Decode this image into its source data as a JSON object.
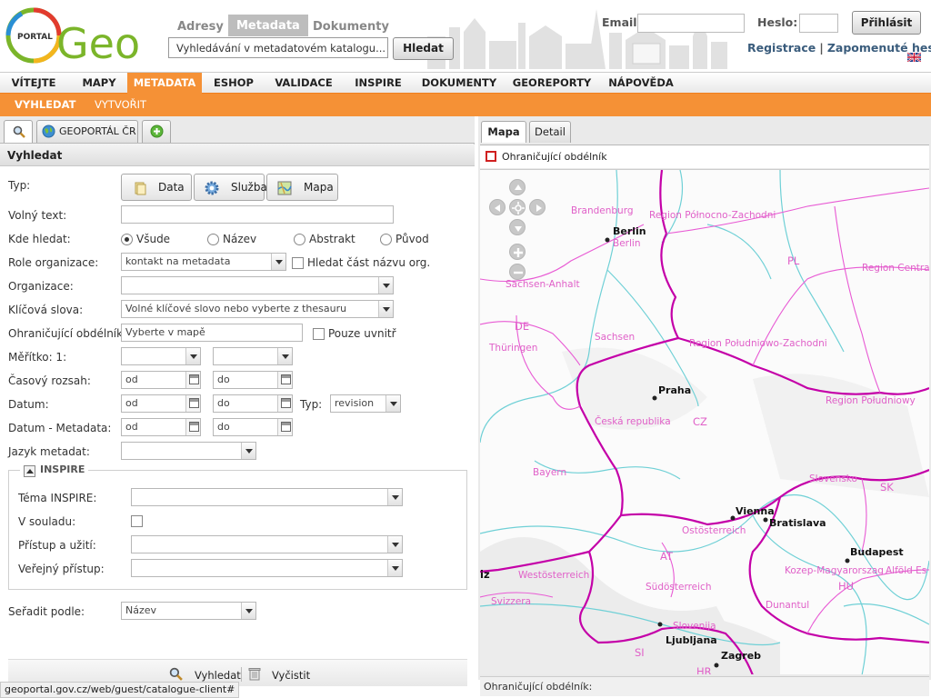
{
  "header": {
    "logo_small": "PORTAL",
    "logo_big": "Geo",
    "topnav": [
      "Adresy",
      "Metadata",
      "Dokumenty"
    ],
    "search_value": "Vyhledávání v metadatovém katalogu...",
    "search_button": "Hledat",
    "email_label": "Email:",
    "password_label": "Heslo:",
    "login_button": "Přihlásit",
    "register_link": "Registrace",
    "separator": "|",
    "forgot_link": "Zapomenuté heslo"
  },
  "mainmenu": [
    "VÍTEJTE",
    "MAPY",
    "METADATA",
    "ESHOP",
    "VALIDACE",
    "INSPIRE",
    "DOKUMENTY",
    "GEOREPORTY",
    "NÁPOVĚDA"
  ],
  "submenu": [
    "VYHLEDAT",
    "VYTVOŘIT"
  ],
  "left": {
    "tab_geoportal": "GEOPORTÁL ČR",
    "section_title": "Vyhledat",
    "labels": {
      "typ": "Typ:",
      "volny_text": "Volný text:",
      "kde_hledat": "Kde hledat:",
      "role": "Role organizace:",
      "organizace": "Organizace:",
      "klicova": "Klíčová slova:",
      "ohranic": "Ohraničující obdélník:",
      "meritko": "Měřítko: 1:",
      "casovy": "Časový rozsah:",
      "datum": "Datum:",
      "datum_meta": "Datum - Metadata:",
      "jazyk": "Jazyk metadat:",
      "seradit": "Seřadit podle:"
    },
    "type_buttons": [
      "Data",
      "Služba",
      "Mapa"
    ],
    "radios": [
      "Všude",
      "Název",
      "Abstrakt",
      "Původ"
    ],
    "role_value": "kontakt na metadata",
    "role_check_label": "Hledat část názvu org.",
    "klicova_placeholder": "Volné klíčové slovo nebo vyberte z thesauru",
    "ohranic_placeholder": "Vyberte v mapě",
    "pouze_uvnitr": "Pouze uvnitř",
    "od": "od",
    "do": "do",
    "typ_label": "Typ:",
    "typ_value": "revision",
    "inspire": {
      "title": "INSPIRE",
      "tema": "Téma INSPIRE:",
      "souladu": "V souladu:",
      "pristup": "Přístup a užití:",
      "verejny": "Veřejný přístup:"
    },
    "sort_value": "Název",
    "btn_search": "Vyhledat",
    "btn_clear": "Vyčistit"
  },
  "right": {
    "tab_map": "Mapa",
    "tab_detail": "Detail",
    "bbox_tool": "Ohraničující obdélník",
    "status_label": "Ohraničující obdélník:",
    "cities": [
      "Berlin",
      "Praha",
      "Vienna",
      "Bratislava",
      "Budapest",
      "Ljubljana",
      "Zagreb"
    ],
    "regions": [
      "Brandenburg",
      "Region Północno-Zachodni",
      "Berlin",
      "PL",
      "Region Centra",
      "Sachsen-Anhalt",
      "DE",
      "Sachsen",
      "Thüringen",
      "Region Południowo-Zachodni",
      "Region Południowy",
      "Česká republika",
      "CZ",
      "Bayern",
      "Slovensko",
      "SK",
      "Ostösterreich",
      "AT",
      "Westösterreich",
      "Südösterreich",
      "Kozep-Magyarorszag",
      "Alföld Es",
      "Dunantul",
      "HU",
      "Slovenija",
      "SI",
      "HR",
      "Svizzera",
      "iz"
    ]
  },
  "urlbar": "geoportal.gov.cz/web/guest/catalogue-client#"
}
